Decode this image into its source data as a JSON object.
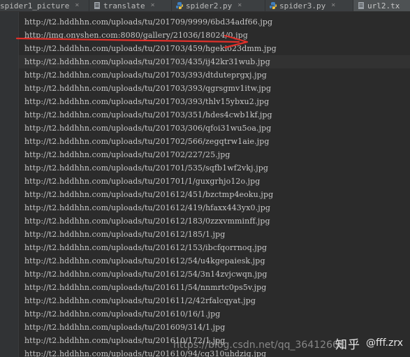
{
  "tabs": [
    {
      "label": "spider1_picture",
      "icon": "python-file-icon",
      "active": false
    },
    {
      "label": "translate",
      "icon": "text-file-icon",
      "active": false
    },
    {
      "label": "spider2.py",
      "icon": "python-file-icon",
      "active": false
    },
    {
      "label": "spider3.py",
      "icon": "python-file-icon",
      "active": false
    },
    {
      "label": "url2.tx",
      "icon": "text-file-icon",
      "active": true
    }
  ],
  "close_glyph": "×",
  "lines": [
    "http://t2.hddhhn.com/uploads/tu/201709/9999/6bd34adf66.jpg",
    "http://img.onyshen.com:8080/gallery/21036/18024/0.jpg",
    "http://t2.hddhhn.com/uploads/tu/201703/459/hgekio23dmm.jpg",
    "http://t2.hddhhn.com/uploads/tu/201703/435/ij42kr31wub.jpg",
    "http://t2.hddhhn.com/uploads/tu/201703/393/dtduteprgxj.jpg",
    "http://t2.hddhhn.com/uploads/tu/201703/393/qgrsgmv1itw.jpg",
    "http://t2.hddhhn.com/uploads/tu/201703/393/thlv15ybxu2.jpg",
    "http://t2.hddhhn.com/uploads/tu/201703/351/hdes4cwb1kf.jpg",
    "http://t2.hddhhn.com/uploads/tu/201703/306/qfoi31wu5oa.jpg",
    "http://t2.hddhhn.com/uploads/tu/201702/566/zegqtrw1aie.jpg",
    "http://t2.hddhhn.com/uploads/tu/201702/227/25.jpg",
    "http://t2.hddhhn.com/uploads/tu/201701/535/sqfb1wf2vkj.jpg",
    "http://t2.hddhhn.com/uploads/tu/201701/1/guxgrhjo12o.jpg",
    "http://t2.hddhhn.com/uploads/tu/201612/451/bzctmp4eoku.jpg",
    "http://t2.hddhhn.com/uploads/tu/201612/419/hfaxx443yx0.jpg",
    "http://t2.hddhhn.com/uploads/tu/201612/183/0zzxvmminff.jpg",
    "http://t2.hddhhn.com/uploads/tu/201612/185/1.jpg",
    "http://t2.hddhhn.com/uploads/tu/201612/153/ibcfqorrnoq.jpg",
    "http://t2.hddhhn.com/uploads/tu/201612/54/u4kgepaiesk.jpg",
    "http://t2.hddhhn.com/uploads/tu/201612/54/3n14zvjcwqn.jpg",
    "http://t2.hddhhn.com/uploads/tu/201611/54/nnmrtc0ps5v.jpg",
    "http://t2.hddhhn.com/uploads/tu/201611/2/42rfalcqyat.jpg",
    "http://t2.hddhhn.com/uploads/tu/201610/16/1.jpg",
    "http://t2.hddhhn.com/uploads/tu/201609/314/1.jpg",
    "http://t2.hddhhn.com/uploads/tu/201610/172/1.jpg",
    "http://t2.hddhhn.com/uploads/tu/201610/94/cg310uhdzig.jpg"
  ],
  "current_line_index": 3,
  "annotation_arrow_color": "#e0302a",
  "watermark": {
    "logo": "知乎",
    "handle": "@fff.zrx"
  },
  "csdn_watermark": "https://blog.csdn.net/qq_36412668",
  "colors": {
    "editor_bg": "#2b2b2b",
    "text": "#c8c8c8",
    "tab_bar": "#3c3f41",
    "python_blue": "#3f7fbf",
    "python_yellow": "#f2c440"
  }
}
